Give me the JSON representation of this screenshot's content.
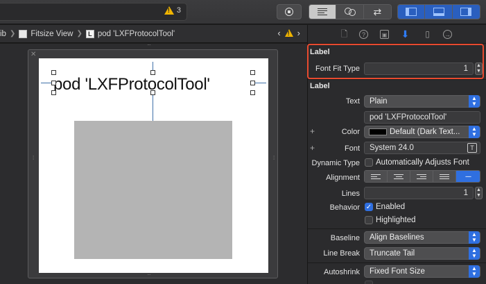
{
  "toolbar": {
    "warning_count": "3",
    "editor_modes": [
      "standard",
      "assistant",
      "version"
    ],
    "panels": [
      "navigator",
      "debug",
      "utilities"
    ]
  },
  "breadcrumb": {
    "items": [
      "ib",
      "Fitsize View",
      "pod 'LXFProtocolTool'"
    ]
  },
  "canvas": {
    "label_text": "pod 'LXFProtocolTool'"
  },
  "inspector": {
    "tabs": [
      "file",
      "quick-help",
      "identity",
      "attributes",
      "size",
      "connections"
    ],
    "section1_title": "Label",
    "font_fit_type_label": "Font Fit Type",
    "font_fit_type_value": "1",
    "section2_title": "Label",
    "text_label": "Text",
    "text_value": "Plain",
    "text_content": "pod 'LXFProtocolTool'",
    "color_label": "Color",
    "color_value": "Default (Dark Text...",
    "font_label": "Font",
    "font_value": "System 24.0",
    "dynamic_type_label": "Dynamic Type",
    "dynamic_type_checkbox": "Automatically Adjusts Font",
    "alignment_label": "Alignment",
    "lines_label": "Lines",
    "lines_value": "1",
    "behavior_label": "Behavior",
    "enabled_label": "Enabled",
    "highlighted_label": "Highlighted",
    "baseline_label": "Baseline",
    "baseline_value": "Align Baselines",
    "line_break_label": "Line Break",
    "line_break_value": "Truncate Tail",
    "autoshrink_label": "Autoshrink",
    "autoshrink_value": "Fixed Font Size"
  },
  "colors": {
    "accent": "#2f6fe0",
    "highlight": "#e84a2f",
    "warning": "#f0b400"
  }
}
